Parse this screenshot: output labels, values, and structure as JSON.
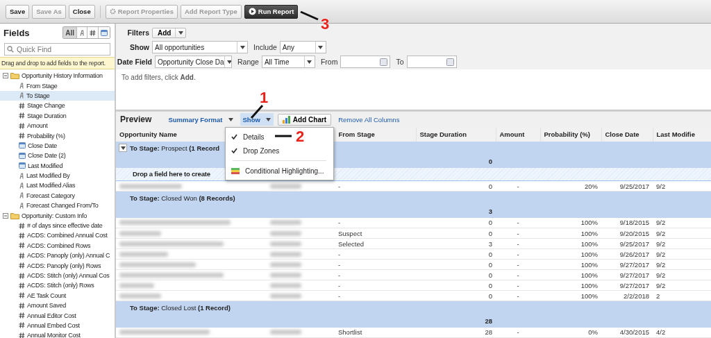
{
  "toolbar": {
    "buttons": [
      {
        "label": "Save",
        "disabled": false,
        "kind": "plain"
      },
      {
        "label": "Save As",
        "disabled": true,
        "kind": "plain"
      },
      {
        "label": "Close",
        "disabled": false,
        "kind": "plain"
      },
      {
        "label": "Report Properties",
        "disabled": true,
        "kind": "gear"
      },
      {
        "label": "Add Report Type",
        "disabled": true,
        "kind": "plain"
      },
      {
        "label": "Run Report",
        "disabled": false,
        "kind": "run"
      }
    ]
  },
  "fields": {
    "title": "Fields",
    "filter_buttons": [
      {
        "kind": "all",
        "label": "All",
        "selected": true
      },
      {
        "kind": "text",
        "selected": false
      },
      {
        "kind": "number",
        "selected": false
      },
      {
        "kind": "date",
        "selected": false
      }
    ],
    "search": {
      "placeholder": "Quick Find"
    },
    "hint": "Drag and drop to add fields to the report.",
    "tree": [
      {
        "label": "Opportunity History Information",
        "expanded": true,
        "children": [
          {
            "label": "From Stage",
            "kind": "text",
            "selected": false
          },
          {
            "label": "To Stage",
            "kind": "text",
            "selected": true
          },
          {
            "label": "Stage Change",
            "kind": "number",
            "selected": false
          },
          {
            "label": "Stage Duration",
            "kind": "number",
            "selected": false
          },
          {
            "label": "Amount",
            "kind": "number",
            "selected": false
          },
          {
            "label": "Probability (%)",
            "kind": "number",
            "selected": false
          },
          {
            "label": "Close Date",
            "kind": "date",
            "selected": false
          },
          {
            "label": "Close Date (2)",
            "kind": "date",
            "selected": false
          },
          {
            "label": "Last Modified",
            "kind": "date",
            "selected": false
          },
          {
            "label": "Last Modified By",
            "kind": "text",
            "selected": false
          },
          {
            "label": "Last Modified Alias",
            "kind": "text",
            "selected": false
          },
          {
            "label": "Forecast Category",
            "kind": "text",
            "selected": false
          },
          {
            "label": "Forecast Changed From/To",
            "kind": "text",
            "selected": false
          }
        ]
      },
      {
        "label": "Opportunity: Custom Info",
        "expanded": true,
        "children": [
          {
            "label": "# of days since effective date",
            "kind": "number",
            "selected": false
          },
          {
            "label": "ACDS: Combined Annual Cost",
            "kind": "number",
            "selected": false
          },
          {
            "label": "ACDS: Combined Rows",
            "kind": "number",
            "selected": false
          },
          {
            "label": "ACDS: Panoply (only) Annual C",
            "kind": "number",
            "selected": false
          },
          {
            "label": "ACDS: Panoply (only) Rows",
            "kind": "number",
            "selected": false
          },
          {
            "label": "ACDS: Stitch (only) Annual Cos",
            "kind": "number",
            "selected": false
          },
          {
            "label": "ACDS: Stitch (only) Rows",
            "kind": "number",
            "selected": false
          },
          {
            "label": "AE Task Count",
            "kind": "number",
            "selected": false
          },
          {
            "label": "Amount Saved",
            "kind": "number",
            "selected": false
          },
          {
            "label": "Annual Editor Cost",
            "kind": "number",
            "selected": false
          },
          {
            "label": "Annual Embed Cost",
            "kind": "number",
            "selected": false
          },
          {
            "label": "Annual Monitor Cost",
            "kind": "number",
            "selected": false
          }
        ]
      }
    ]
  },
  "filters": {
    "label": "Filters",
    "add_button": "Add",
    "show": {
      "label": "Show",
      "value": "All opportunities"
    },
    "include": {
      "label": "Include",
      "value": "Any"
    },
    "date_field": {
      "label": "Date Field",
      "value": "Opportunity Close Da"
    },
    "range": {
      "label": "Range",
      "value": "All Time"
    },
    "from": {
      "label": "From"
    },
    "to": {
      "label": "To"
    },
    "empty_message": "To add filters, click **Add**."
  },
  "preview": {
    "title": "Preview",
    "format": "Summary Format",
    "show": "Show",
    "add_chart": "Add Chart",
    "remove_columns": "Remove All Columns",
    "menu": [
      {
        "kind": "check",
        "label": "Details",
        "checked": true
      },
      {
        "kind": "check",
        "label": "Drop Zones",
        "checked": true
      },
      {
        "kind": "highlight",
        "label": "Conditional Highlighting..."
      }
    ]
  },
  "table": {
    "columns": [
      "Opportunity Name",
      "From Stage",
      "Stage Duration",
      "Amount",
      "Probability (%)",
      "Close Date",
      "Last Modifie"
    ],
    "groups": [
      {
        "label": "**To Stage:** Prospect **(1 Record**",
        "collapsible": true,
        "total": "0",
        "drop_zone": "Drop a field here to create",
        "rows": [
          [
            "-",
            "0",
            "-",
            "20%",
            "9/25/2017",
            "9/2"
          ]
        ]
      },
      {
        "label": "**To Stage:** Closed Won **(8 Records)**",
        "collapsible": false,
        "total": "3",
        "rows": [
          [
            "-",
            "0",
            "-",
            "100%",
            "9/18/2015",
            "9/2"
          ],
          [
            "Suspect",
            "0",
            "-",
            "100%",
            "9/20/2015",
            "9/2"
          ],
          [
            "Selected",
            "3",
            "-",
            "100%",
            "9/25/2017",
            "9/2"
          ],
          [
            "-",
            "0",
            "-",
            "100%",
            "9/26/2017",
            "9/2"
          ],
          [
            "-",
            "0",
            "-",
            "100%",
            "9/27/2017",
            "9/2"
          ],
          [
            "-",
            "0",
            "-",
            "100%",
            "9/27/2017",
            "9/2"
          ],
          [
            "-",
            "0",
            "-",
            "100%",
            "9/27/2017",
            "9/2"
          ],
          [
            "-",
            "0",
            "-",
            "100%",
            "2/2/2018",
            "2"
          ]
        ]
      },
      {
        "label": "**To Stage:** Closed Lost **(1 Record)**",
        "collapsible": false,
        "total": "28",
        "rows": [
          [
            "Shortlist",
            "28",
            "-",
            "0%",
            "4/30/2015",
            "4/2"
          ]
        ]
      }
    ]
  },
  "callouts": [
    {
      "label": "1"
    },
    {
      "label": "2"
    },
    {
      "label": "3"
    }
  ]
}
